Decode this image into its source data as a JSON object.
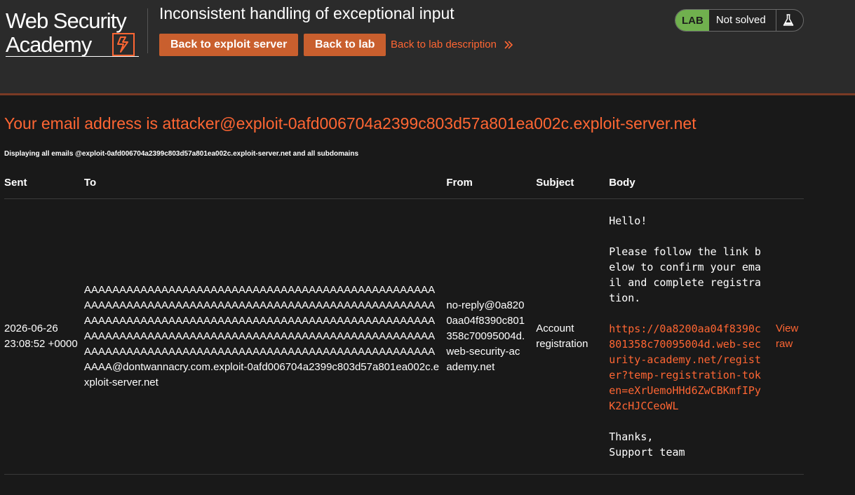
{
  "header": {
    "logo_line1": "Web Security",
    "logo_line2": "Academy",
    "lab_title": "Inconsistent handling of exceptional input",
    "back_exploit": "Back to exploit server",
    "back_lab": "Back to lab",
    "back_description": "Back to lab description",
    "status_badge": "LAB",
    "status_text": "Not solved"
  },
  "main": {
    "email_prefix": "Your email address is ",
    "email_address": "attacker@exploit-0afd006704a2399c803d57a801ea002c.exploit-server.net",
    "displaying": "Displaying all emails @exploit-0afd006704a2399c803d57a801ea002c.exploit-server.net and all subdomains",
    "columns": [
      "Sent",
      "To",
      "From",
      "Subject",
      "Body"
    ],
    "email": {
      "sent": "2026-06-26 23:08:52 +0000",
      "to": "AAAAAAAAAAAAAAAAAAAAAAAAAAAAAAAAAAAAAAAAAAAAAAAAAAAAAAAAAAAAAAAAAAAAAAAAAAAAAAAAAAAAAAAAAAAAAAAAAAAAAAAAAAAAAAAAAAAAAAAAAAAAAAAAAAAAAAAAAAAAAAAAAAAAAAAAAAAAAAAAAAAAAAAAAAAAAAAAAAAAAAAAAAAAAAAAAAAAAAAAAAAAAAAAAAAAAAAAAAAAAAAAAAAAAAAAAAAAAAAAAAAAAAAAAAAAAA@dontwannacry.com.exploit-0afd006704a2399c803d57a801ea002c.exploit-server.net",
      "from": "no-reply@0a8200aa04f8390c801358c70095004d.web-security-academy.net",
      "subject": "Account registration",
      "body_intro": "Hello!\n\nPlease follow the link below to confirm your email and complete registration.\n\n",
      "body_link": "https://0a8200aa04f8390c801358c70095004d.web-security-academy.net/register?temp-registration-token=eXrUemoHHd6ZwCBKmfIPyK2cHJCCeoWL",
      "body_outro": "\n\nThanks,\nSupport team",
      "view_raw": "View raw"
    }
  },
  "colors": {
    "accent": "#ff6633",
    "button": "#c95f2e",
    "lab_badge": "#70b04e",
    "background": "#191919",
    "header_bg": "#2b2b2b"
  },
  "icons": [
    "logo-bolt-icon",
    "chevron-right-double-icon",
    "flask-icon"
  ]
}
